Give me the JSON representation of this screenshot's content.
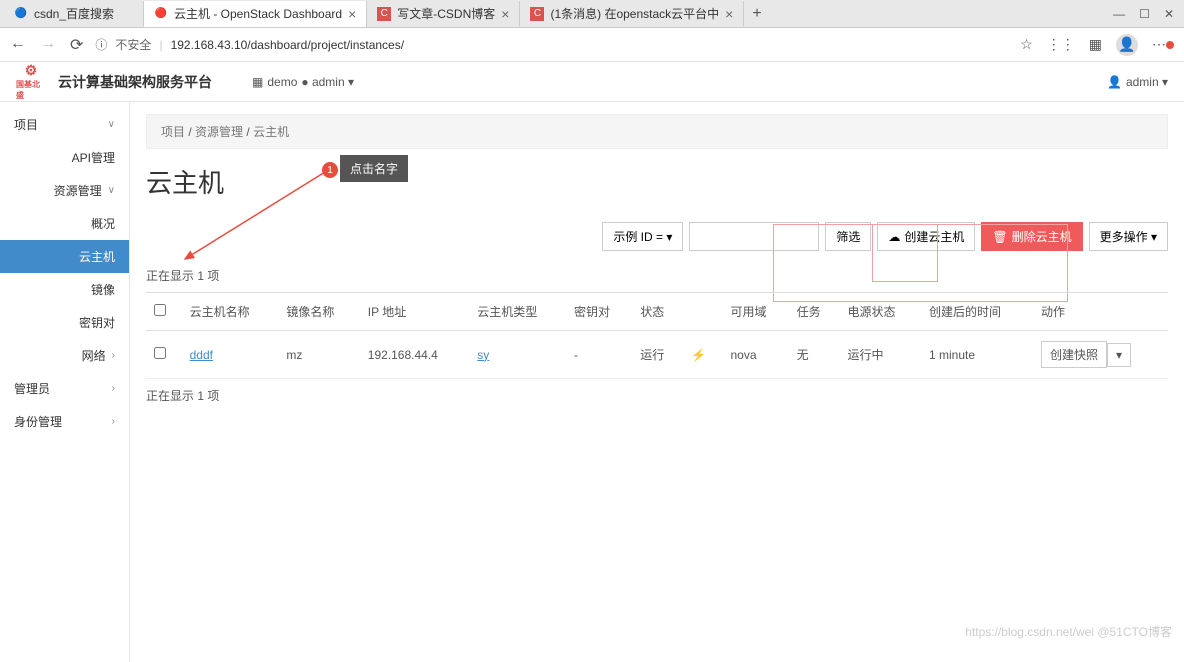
{
  "browser": {
    "tabs": [
      {
        "title": "csdn_百度搜索",
        "icon": "🔵"
      },
      {
        "title": "云主机 - OpenStack Dashboard",
        "icon": "🔴",
        "active": true
      },
      {
        "title": "写文章-CSDN博客",
        "icon": "C"
      },
      {
        "title": "(1条消息) 在openstack云平台中",
        "icon": "C"
      }
    ],
    "url_secure_label": "不安全",
    "url": "192.168.43.10/dashboard/project/instances/",
    "window": {
      "min": "—",
      "max": "☐",
      "close": "✕"
    }
  },
  "header": {
    "logo_text": "国基北盛",
    "brand": "云计算基础架构服务平台",
    "project_icon": "▦",
    "project": "demo",
    "admin_indicator": "● admin ▾",
    "user_icon": "👤",
    "user": "admin ▾"
  },
  "sidebar": {
    "items": [
      {
        "label": "项目",
        "chevron": "∨"
      },
      {
        "label": "API管理",
        "sub": true
      },
      {
        "label": "资源管理",
        "chevron": "∨",
        "sub": true
      },
      {
        "label": "概况",
        "sub2": true
      },
      {
        "label": "云主机",
        "sub2": true,
        "active": true
      },
      {
        "label": "镜像",
        "sub2": true
      },
      {
        "label": "密钥对",
        "sub2": true
      },
      {
        "label": "网络",
        "chevron": "›",
        "sub": true
      },
      {
        "label": "管理员",
        "chevron": "›"
      },
      {
        "label": "身份管理",
        "chevron": "›"
      }
    ]
  },
  "breadcrumb": {
    "parts": [
      "项目",
      "资源管理",
      "云主机"
    ]
  },
  "page": {
    "title": "云主机"
  },
  "annotation": {
    "number": "1",
    "text": "点击名字"
  },
  "toolbar": {
    "filter_dropdown": "示例 ID = ▾",
    "search_placeholder": "",
    "filter_btn": "筛选",
    "create_btn": "创建云主机",
    "create_icon": "☁",
    "delete_btn": "删除云主机",
    "delete_icon": "🗑",
    "more_btn": "更多操作 ▾"
  },
  "table": {
    "showing_top": "正在显示 1 项",
    "showing_bottom": "正在显示 1 项",
    "headers": {
      "name": "云主机名称",
      "image": "镜像名称",
      "ip": "IP 地址",
      "flavor": "云主机类型",
      "keypair": "密钥对",
      "status": "状态",
      "zone": "可用域",
      "task": "任务",
      "power": "电源状态",
      "created": "创建后的时间",
      "actions": "动作"
    },
    "rows": [
      {
        "name": "dddf",
        "image": "mz",
        "ip": "192.168.44.4",
        "flavor": "sy",
        "keypair": "-",
        "status": "运行",
        "status_icon": "⚡",
        "zone": "nova",
        "task": "无",
        "power": "运行中",
        "created": "1 minute",
        "action": "创建快照",
        "action_drop": "▾"
      }
    ]
  },
  "watermark": "https://blog.csdn.net/wei @51CTO博客"
}
